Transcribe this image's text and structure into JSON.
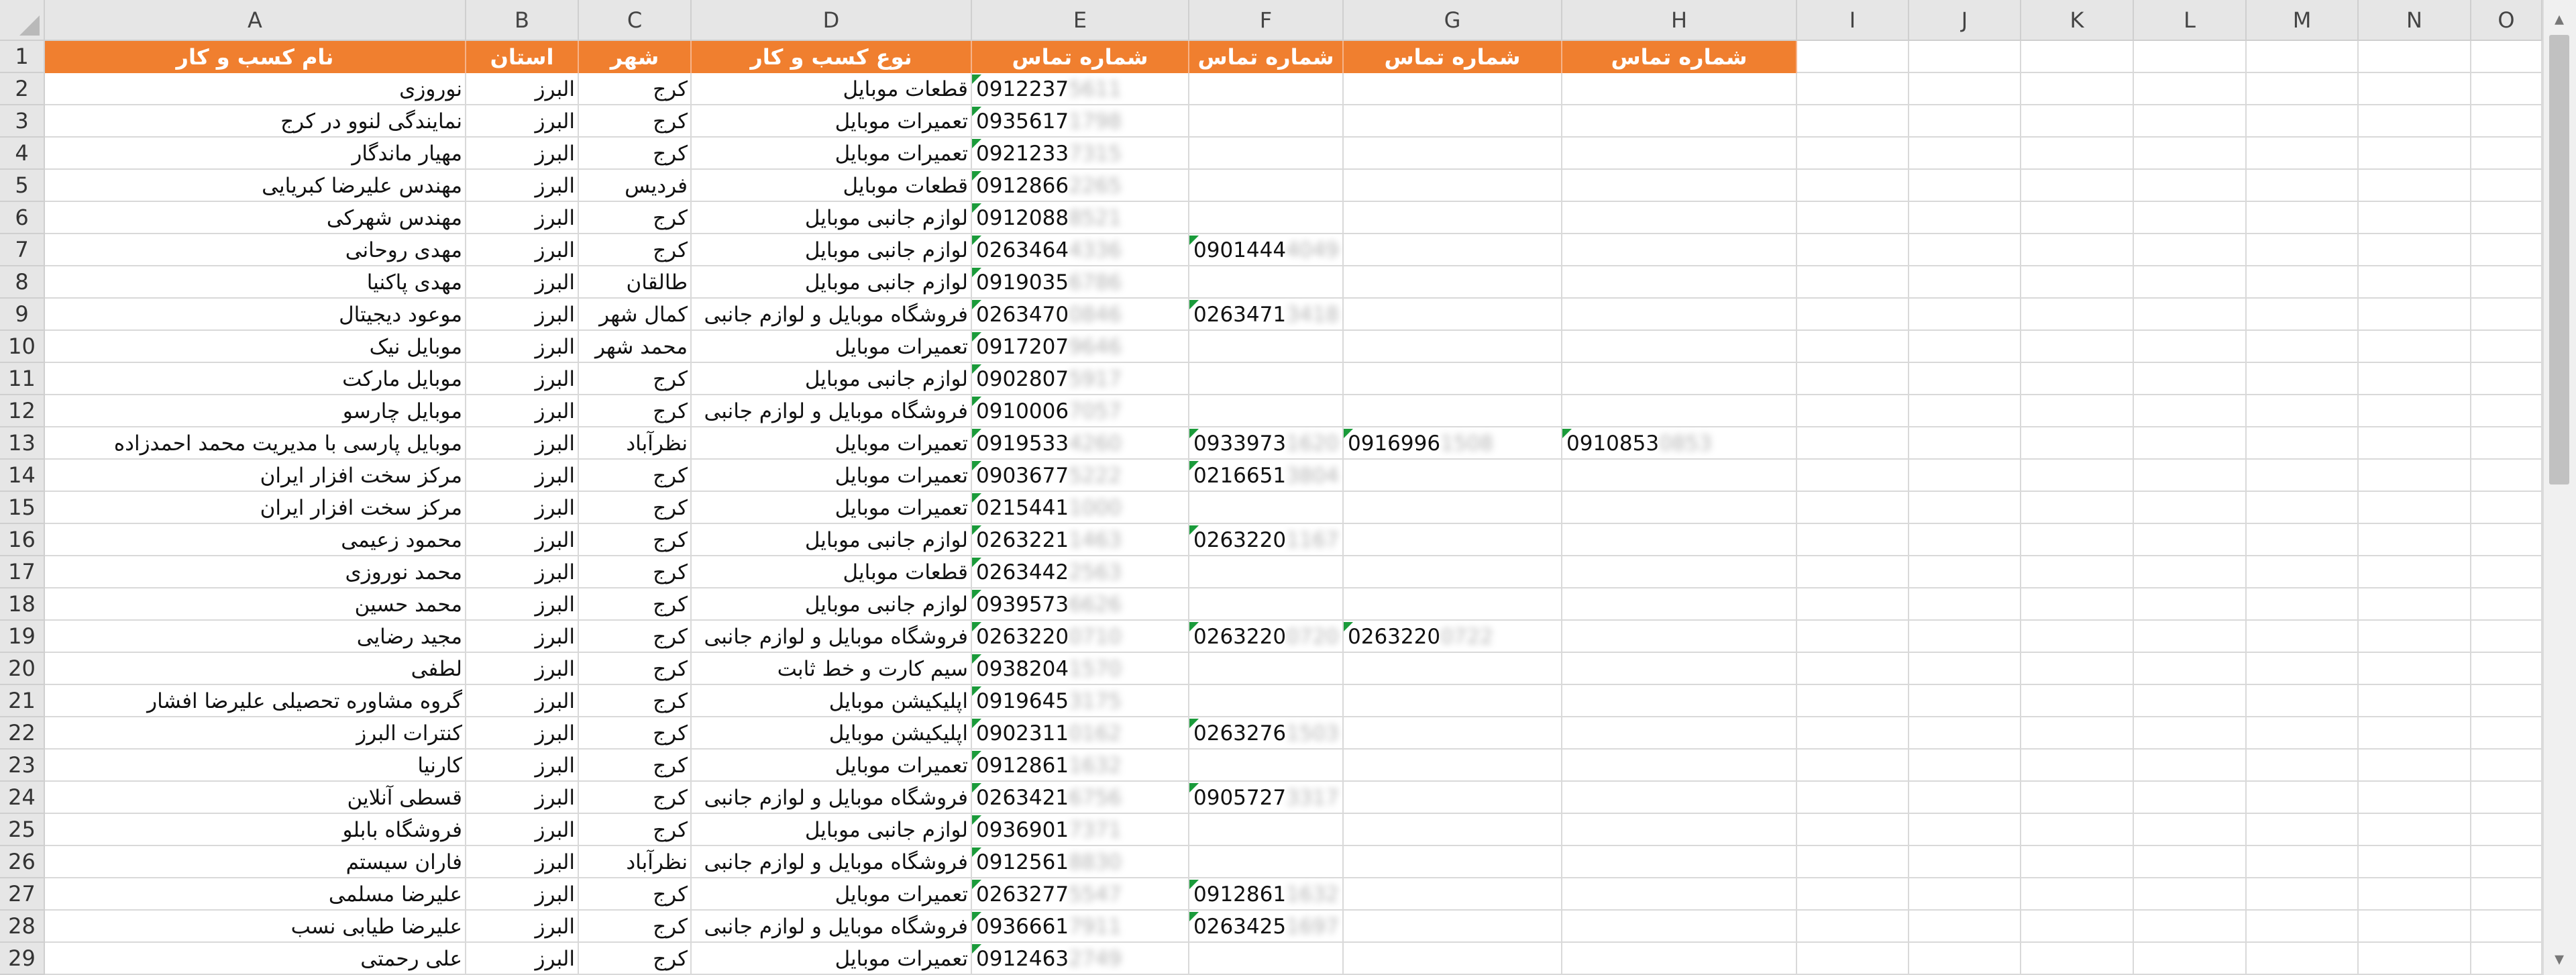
{
  "columns": [
    "A",
    "B",
    "C",
    "D",
    "E",
    "F",
    "G",
    "H",
    "I",
    "J",
    "K",
    "L",
    "M",
    "N",
    "O"
  ],
  "row_numbers": [
    "1",
    "2",
    "3",
    "4",
    "5",
    "6",
    "7",
    "8",
    "9",
    "10",
    "11",
    "12",
    "13",
    "14",
    "15",
    "16",
    "17",
    "18",
    "19",
    "20",
    "21",
    "22",
    "23",
    "24",
    "25",
    "26",
    "27",
    "28",
    "29"
  ],
  "header": {
    "name": "نام کسب و کار",
    "province": "استان",
    "city": "شهر",
    "type": "نوع کسب و کار",
    "phone1": "شماره تماس",
    "phone2": "شماره تماس",
    "phone3": "شماره تماس",
    "phone4": "شماره تماس"
  },
  "colors": {
    "header_fill": "#f07f2f",
    "header_text": "#ffffff",
    "comment_marker": "#1a9b3a"
  },
  "rows": [
    {
      "name": "نوروزی",
      "province": "البرز",
      "city": "کرج",
      "type": "قطعات موبایل",
      "p1": "0912237",
      "p1b": "5611",
      "p2": "",
      "p2b": "",
      "p3": "",
      "p3b": "",
      "p4": "",
      "p4b": ""
    },
    {
      "name": "نمایندگی لنوو در کرج",
      "province": "البرز",
      "city": "کرج",
      "type": "تعمیرات موبایل",
      "p1": "0935617",
      "p1b": "1798",
      "p2": "",
      "p2b": "",
      "p3": "",
      "p3b": "",
      "p4": "",
      "p4b": ""
    },
    {
      "name": "مهیار ماندگار",
      "province": "البرز",
      "city": "کرج",
      "type": "تعمیرات موبایل",
      "p1": "0921233",
      "p1b": "7315",
      "p2": "",
      "p2b": "",
      "p3": "",
      "p3b": "",
      "p4": "",
      "p4b": ""
    },
    {
      "name": "مهندس علیرضا کبریایی",
      "province": "البرز",
      "city": "فردیس",
      "type": "قطعات موبایل",
      "p1": "0912866",
      "p1b": "2265",
      "p2": "",
      "p2b": "",
      "p3": "",
      "p3b": "",
      "p4": "",
      "p4b": ""
    },
    {
      "name": "مهندس شهرکی",
      "province": "البرز",
      "city": "کرج",
      "type": "لوازم جانبی موبایل",
      "p1": "0912088",
      "p1b": "8521",
      "p2": "",
      "p2b": "",
      "p3": "",
      "p3b": "",
      "p4": "",
      "p4b": ""
    },
    {
      "name": "مهدی روحانی",
      "province": "البرز",
      "city": "کرج",
      "type": "لوازم جانبی موبایل",
      "p1": "0263464",
      "p1b": "4336",
      "p2": "0901444",
      "p2b": "4049",
      "p3": "",
      "p3b": "",
      "p4": "",
      "p4b": ""
    },
    {
      "name": "مهدی پاکنیا",
      "province": "البرز",
      "city": "طالقان",
      "type": "لوازم جانبی موبایل",
      "p1": "0919035",
      "p1b": "6786",
      "p2": "",
      "p2b": "",
      "p3": "",
      "p3b": "",
      "p4": "",
      "p4b": ""
    },
    {
      "name": "موعود دیجیتال",
      "province": "البرز",
      "city": "کمال شهر",
      "type": "فروشگاه موبایل و لوازم جانبی",
      "p1": "0263470",
      "p1b": "0846",
      "p2": "0263471",
      "p2b": "3418",
      "p3": "",
      "p3b": "",
      "p4": "",
      "p4b": ""
    },
    {
      "name": "موبایل نیک",
      "province": "البرز",
      "city": "محمد شهر",
      "type": "تعمیرات موبایل",
      "p1": "0917207",
      "p1b": "9646",
      "p2": "",
      "p2b": "",
      "p3": "",
      "p3b": "",
      "p4": "",
      "p4b": ""
    },
    {
      "name": "موبایل مارکت",
      "province": "البرز",
      "city": "کرج",
      "type": "لوازم جانبی موبایل",
      "p1": "0902807",
      "p1b": "5917",
      "p2": "",
      "p2b": "",
      "p3": "",
      "p3b": "",
      "p4": "",
      "p4b": ""
    },
    {
      "name": "موبایل چارسو",
      "province": "البرز",
      "city": "کرج",
      "type": "فروشگاه موبایل و لوازم جانبی",
      "p1": "0910006",
      "p1b": "7057",
      "p2": "",
      "p2b": "",
      "p3": "",
      "p3b": "",
      "p4": "",
      "p4b": ""
    },
    {
      "name": "موبایل پارسی با مدیریت محمد احمدزاده",
      "province": "البرز",
      "city": "نظرآباد",
      "type": "تعمیرات موبایل",
      "p1": "0919533",
      "p1b": "4260",
      "p2": "0933973",
      "p2b": "1620",
      "p3": "0916996",
      "p3b": "1508",
      "p4": "0910853",
      "p4b": "0853"
    },
    {
      "name": "مرکز سخت افزار ایران",
      "province": "البرز",
      "city": "کرج",
      "type": "تعمیرات موبایل",
      "p1": "0903677",
      "p1b": "5222",
      "p2": "0216651",
      "p2b": "3804",
      "p3": "",
      "p3b": "",
      "p4": "",
      "p4b": ""
    },
    {
      "name": "مرکز سخت افزار ایران",
      "province": "البرز",
      "city": "کرج",
      "type": "تعمیرات موبایل",
      "p1": "0215441",
      "p1b": "1000",
      "p2": "",
      "p2b": "",
      "p3": "",
      "p3b": "",
      "p4": "",
      "p4b": ""
    },
    {
      "name": "محمود زعیمی",
      "province": "البرز",
      "city": "کرج",
      "type": "لوازم جانبی موبایل",
      "p1": "0263221",
      "p1b": "1463",
      "p2": "0263220",
      "p2b": "1167",
      "p3": "",
      "p3b": "",
      "p4": "",
      "p4b": ""
    },
    {
      "name": "محمد نوروزی",
      "province": "البرز",
      "city": "کرج",
      "type": "قطعات موبایل",
      "p1": "0263442",
      "p1b": "2563",
      "p2": "",
      "p2b": "",
      "p3": "",
      "p3b": "",
      "p4": "",
      "p4b": ""
    },
    {
      "name": "محمد حسین",
      "province": "البرز",
      "city": "کرج",
      "type": "لوازم جانبی موبایل",
      "p1": "0939573",
      "p1b": "6626",
      "p2": "",
      "p2b": "",
      "p3": "",
      "p3b": "",
      "p4": "",
      "p4b": ""
    },
    {
      "name": "مجید رضایی",
      "province": "البرز",
      "city": "کرج",
      "type": "فروشگاه موبایل و لوازم جانبی",
      "p1": "0263220",
      "p1b": "0710",
      "p2": "0263220",
      "p2b": "0720",
      "p3": "0263220",
      "p3b": "0722",
      "p4": "",
      "p4b": ""
    },
    {
      "name": "لطفی",
      "province": "البرز",
      "city": "کرج",
      "type": "سیم کارت و خط ثابت",
      "p1": "0938204",
      "p1b": "1570",
      "p2": "",
      "p2b": "",
      "p3": "",
      "p3b": "",
      "p4": "",
      "p4b": ""
    },
    {
      "name": "گروه مشاوره تحصیلی علیرضا افشار",
      "province": "البرز",
      "city": "کرج",
      "type": "اپلیکیشن موبایل",
      "p1": "0919645",
      "p1b": "3175",
      "p2": "",
      "p2b": "",
      "p3": "",
      "p3b": "",
      "p4": "",
      "p4b": ""
    },
    {
      "name": "کنترات البرز",
      "province": "البرز",
      "city": "کرج",
      "type": "اپلیکیشن موبایل",
      "p1": "0902311",
      "p1b": "0162",
      "p2": "0263276",
      "p2b": "1503",
      "p3": "",
      "p3b": "",
      "p4": "",
      "p4b": ""
    },
    {
      "name": "کارنیا",
      "province": "البرز",
      "city": "کرج",
      "type": "تعمیرات موبایل",
      "p1": "0912861",
      "p1b": "1632",
      "p2": "",
      "p2b": "",
      "p3": "",
      "p3b": "",
      "p4": "",
      "p4b": ""
    },
    {
      "name": "قسطی آنلاین",
      "province": "البرز",
      "city": "کرج",
      "type": "فروشگاه موبایل و لوازم جانبی",
      "p1": "0263421",
      "p1b": "6756",
      "p2": "0905727",
      "p2b": "3317",
      "p3": "",
      "p3b": "",
      "p4": "",
      "p4b": ""
    },
    {
      "name": "فروشگاه بابلو",
      "province": "البرز",
      "city": "کرج",
      "type": "لوازم جانبی موبایل",
      "p1": "0936901",
      "p1b": "7371",
      "p2": "",
      "p2b": "",
      "p3": "",
      "p3b": "",
      "p4": "",
      "p4b": ""
    },
    {
      "name": "فاران سیستم",
      "province": "البرز",
      "city": "نظرآباد",
      "type": "فروشگاه موبایل و لوازم جانبی",
      "p1": "0912561",
      "p1b": "8830",
      "p2": "",
      "p2b": "",
      "p3": "",
      "p3b": "",
      "p4": "",
      "p4b": ""
    },
    {
      "name": "علیرضا مسلمی",
      "province": "البرز",
      "city": "کرج",
      "type": "تعمیرات موبایل",
      "p1": "0263277",
      "p1b": "5547",
      "p2": "0912861",
      "p2b": "1632",
      "p3": "",
      "p3b": "",
      "p4": "",
      "p4b": ""
    },
    {
      "name": "علیرضا طیابی نسب",
      "province": "البرز",
      "city": "کرج",
      "type": "فروشگاه موبایل و لوازم جانبی",
      "p1": "0936661",
      "p1b": "7911",
      "p2": "0263425",
      "p2b": "1697",
      "p3": "",
      "p3b": "",
      "p4": "",
      "p4b": ""
    },
    {
      "name": "علی رحمتی",
      "province": "البرز",
      "city": "کرج",
      "type": "تعمیرات موبایل",
      "p1": "0912463",
      "p1b": "2749",
      "p2": "",
      "p2b": "",
      "p3": "",
      "p3b": "",
      "p4": "",
      "p4b": ""
    }
  ]
}
